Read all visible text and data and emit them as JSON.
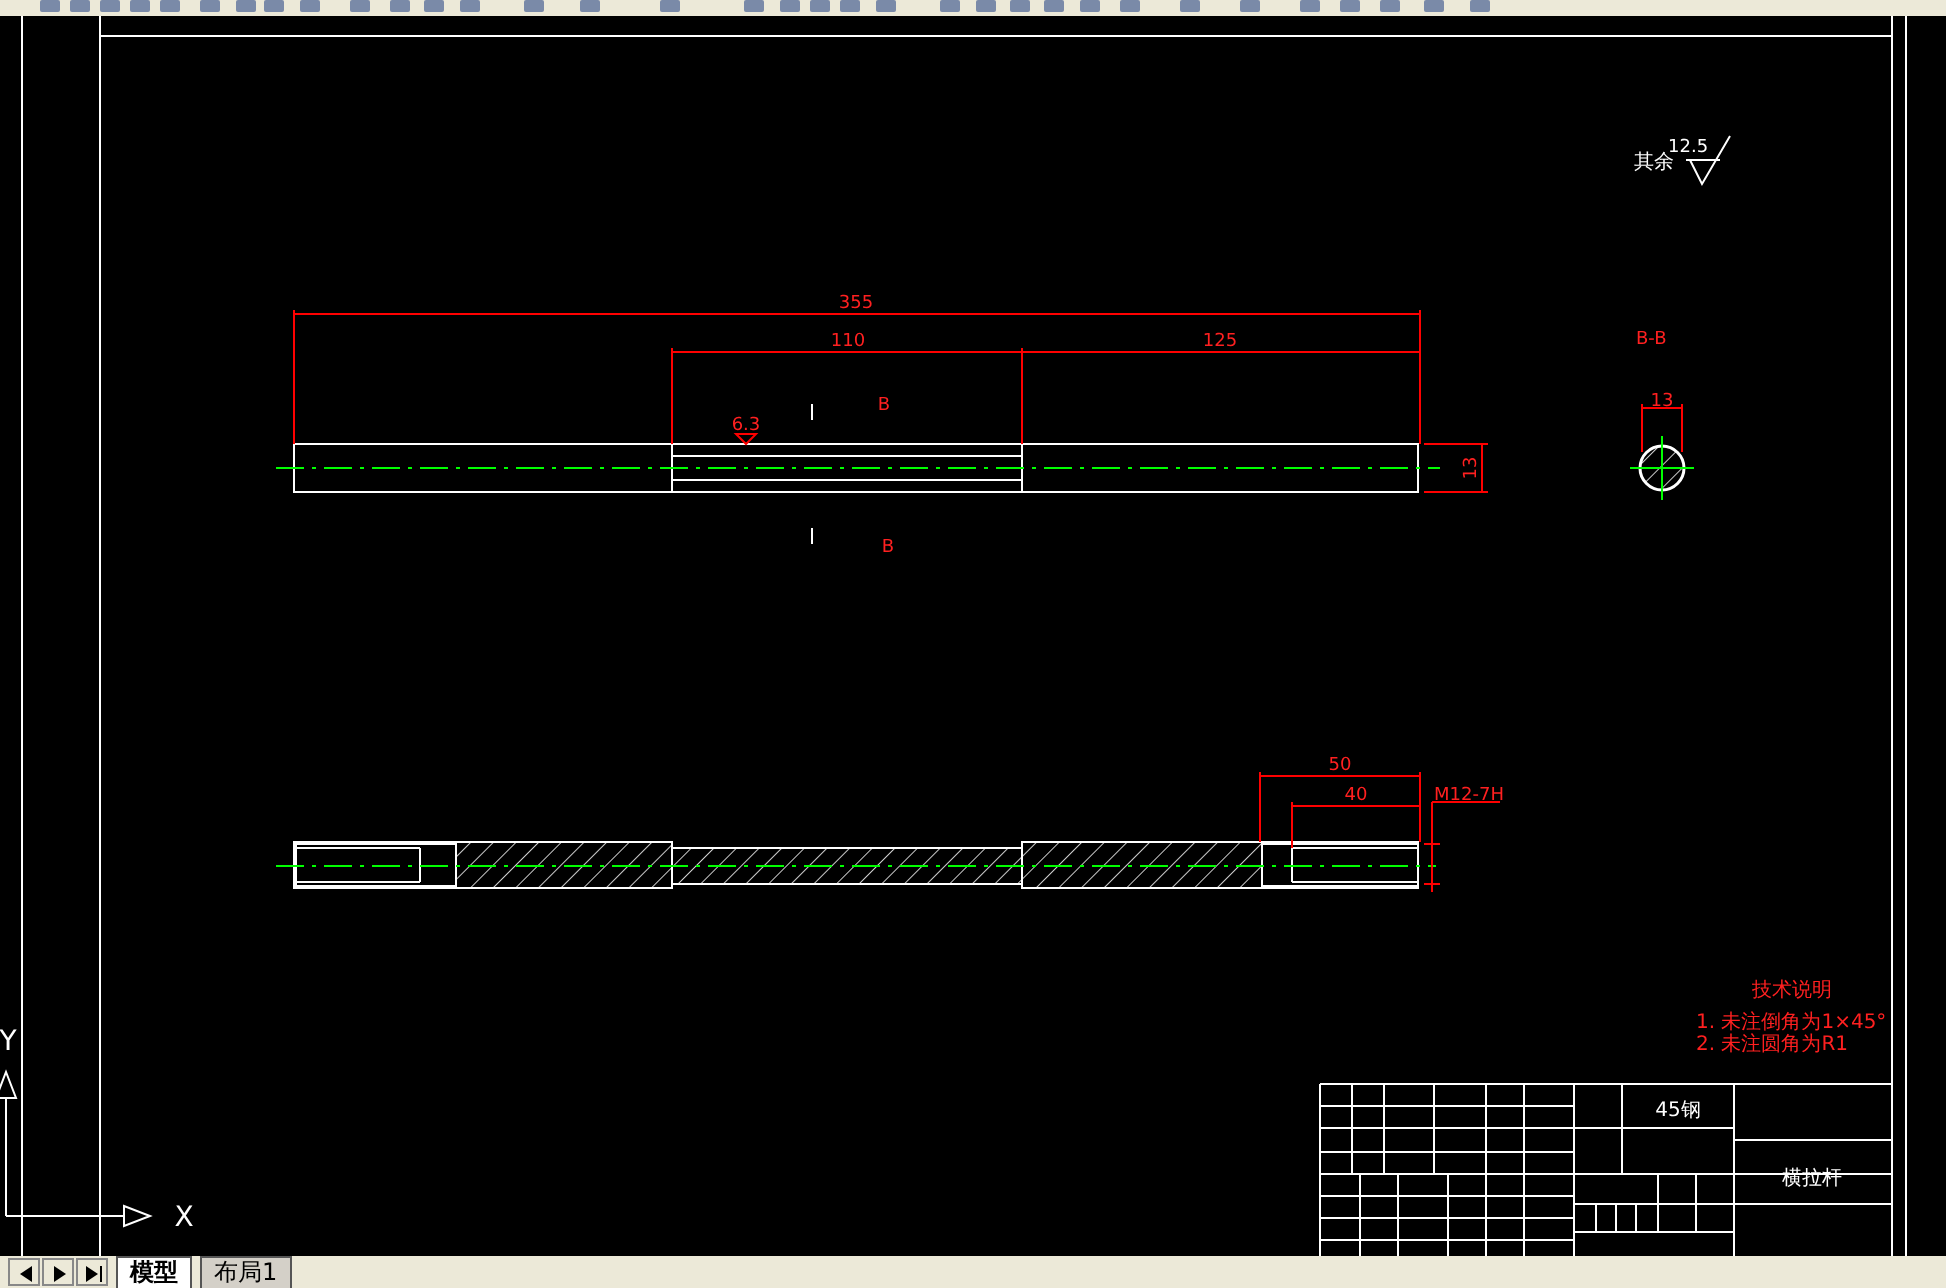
{
  "drawing": {
    "overall_length": "355",
    "middle_length": "110",
    "right_length": "125",
    "diameter": "13",
    "roughness": "6.3",
    "section_marks": [
      "B",
      "B"
    ],
    "section_title": "B-B",
    "section_diameter": "13",
    "thread_length": "50",
    "thread_depth": "40",
    "thread_spec": "M12-7H",
    "default_roughness_label": "其余",
    "default_roughness": "12.5"
  },
  "notes": {
    "title": "技术说明",
    "items": [
      "1. 未注倒角为1×45°",
      "2. 未注圆角为R1"
    ]
  },
  "title_block": {
    "material": "45钢",
    "part_name": "横拉杆"
  },
  "ucs": {
    "x_label": "X",
    "y_label": "Y"
  },
  "tabs": [
    {
      "label": "模型",
      "selected": true
    },
    {
      "label": "布局1",
      "selected": false
    }
  ]
}
